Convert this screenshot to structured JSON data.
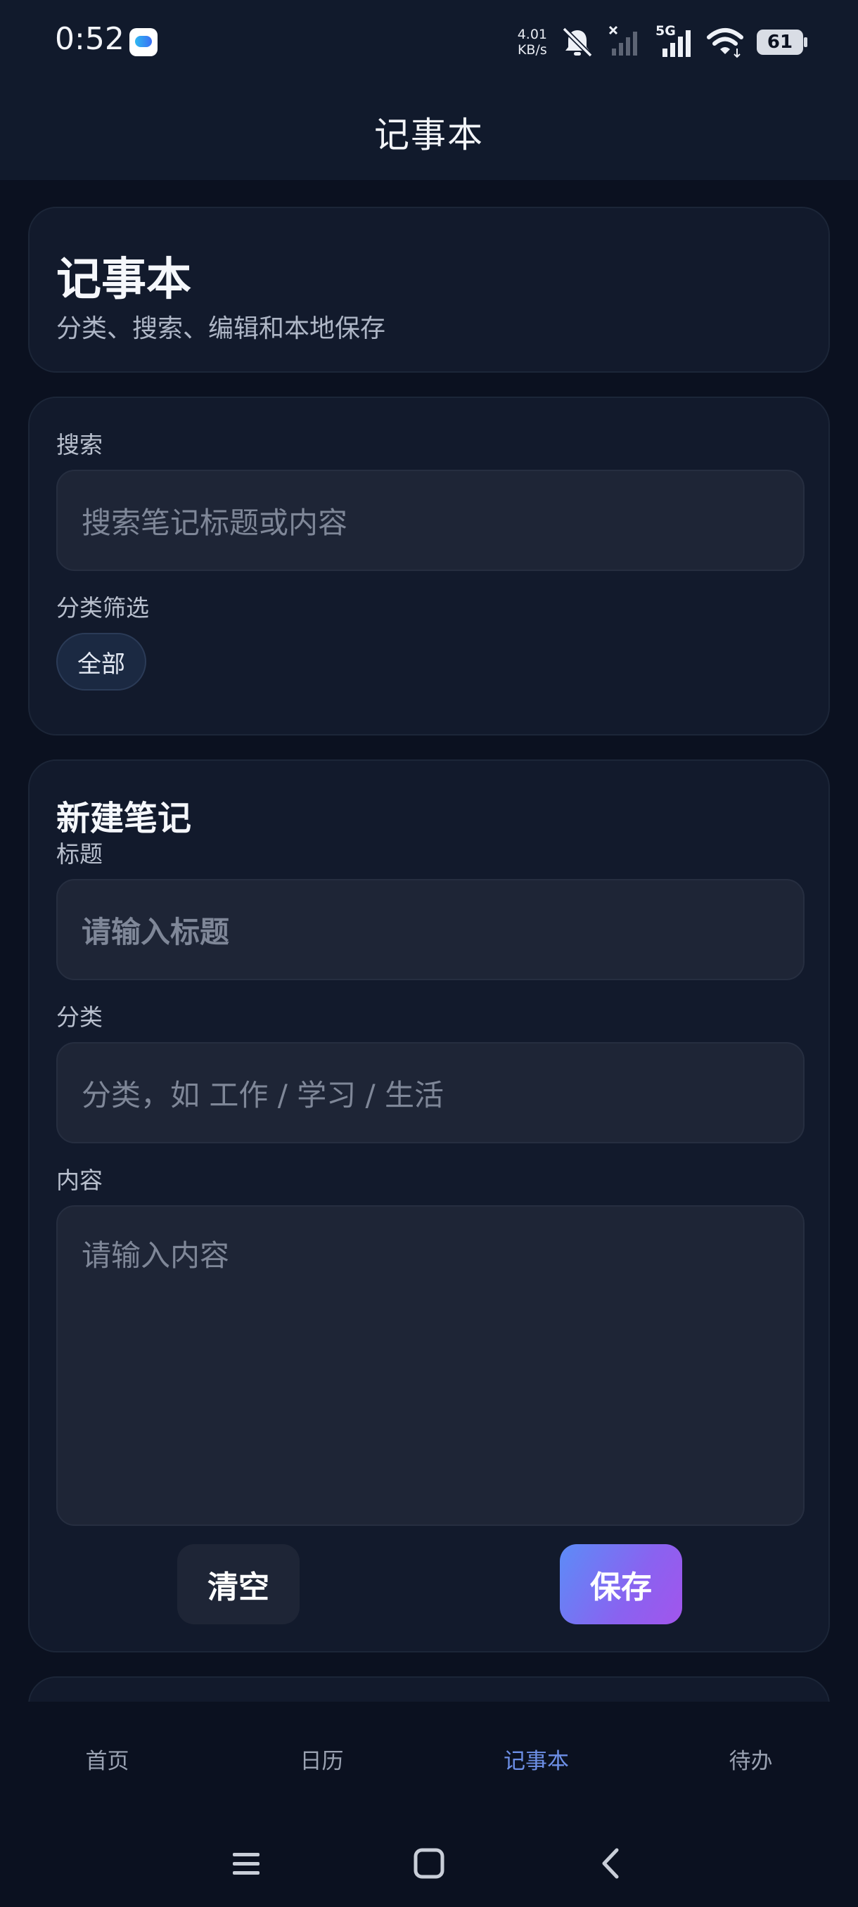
{
  "status_bar": {
    "time": "0:52",
    "net_speed_value": "4.01",
    "net_speed_unit": "KB/s",
    "network_type": "5G",
    "battery_level": "61",
    "icons": [
      "cloud-app-icon",
      "bell-mute-icon",
      "signal-off-icon",
      "signal-5g-icon",
      "wifi-icon",
      "battery-icon"
    ]
  },
  "header": {
    "title": "记事本"
  },
  "hero": {
    "title": "记事本",
    "subtitle": "分类、搜索、编辑和本地保存"
  },
  "filter": {
    "search_label": "搜索",
    "search_placeholder": "搜索笔记标题或内容",
    "category_label": "分类筛选",
    "chips": [
      "全部"
    ]
  },
  "new_note": {
    "section_title": "新建笔记",
    "title_label": "标题",
    "title_placeholder": "请输入标题",
    "category_label": "分类",
    "category_placeholder": "分类，如 工作 / 学习 / 生活",
    "content_label": "内容",
    "content_placeholder": "请输入内容",
    "clear_label": "清空",
    "save_label": "保存"
  },
  "bottom_nav": {
    "items": [
      {
        "label": "首页",
        "active": false
      },
      {
        "label": "日历",
        "active": false
      },
      {
        "label": "记事本",
        "active": true
      },
      {
        "label": "待办",
        "active": false
      }
    ]
  },
  "system_nav": {
    "icons": [
      "menu-icon",
      "home-icon",
      "back-icon"
    ]
  },
  "colors": {
    "accent": "#6d8fe6",
    "background": "#0b1120",
    "card": "#121a2c",
    "save_gradient_start": "#5c8cf7",
    "save_gradient_end": "#a255ec"
  }
}
